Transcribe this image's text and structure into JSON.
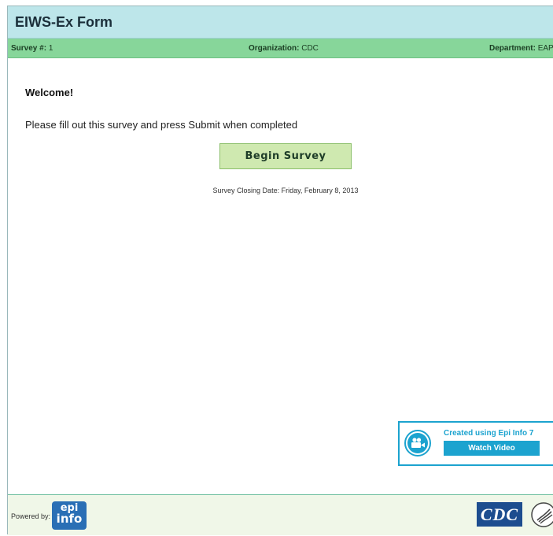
{
  "header": {
    "title": "EIWS-Ex Form"
  },
  "info": {
    "survey_label": "Survey #:",
    "survey_value": "1",
    "organization_label": "Organization:",
    "organization_value": "CDC",
    "department_label": "Department:",
    "department_value": "EAP"
  },
  "main": {
    "welcome": "Welcome!",
    "instructions": "Please fill out this survey and press Submit when completed",
    "begin_label": "Begin Survey",
    "closing": "Survey Closing Date: Friday, February 8, 2013"
  },
  "video": {
    "caption": "Created using Epi Info 7",
    "watch_label": "Watch Video",
    "icon": "video-camera-icon",
    "accent": "#1ca3cf"
  },
  "footer": {
    "powered_by": "Powered by:",
    "epi_logo_top": "epi",
    "epi_logo_bottom": "info",
    "cdc_logo": "CDC"
  },
  "colors": {
    "titlebar": "#bde6ea",
    "infobar": "#87d69a",
    "begin_button": "#cfe9b0",
    "footer": "#f0f7e8"
  }
}
